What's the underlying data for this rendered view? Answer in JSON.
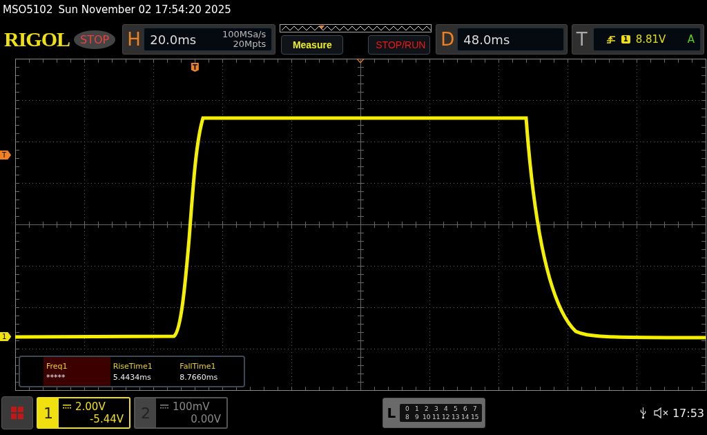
{
  "header": {
    "model": "MSO5102",
    "datetime": "Sun November 02 17:54:20 2025"
  },
  "toolbar": {
    "logo": "RIGOL",
    "run_state": "STOP",
    "running": false
  },
  "horizontal": {
    "letter": "H",
    "timebase": "20.0ms",
    "sample_rate": "100MSa/s",
    "memory_depth": "20Mpts"
  },
  "buttons": [
    {
      "label": "Measure",
      "kind": "measure"
    },
    {
      "label": "STOP/RUN",
      "kind": "run-control"
    }
  ],
  "delay": {
    "letter": "D",
    "value": "48.0ms"
  },
  "trigger": {
    "letter": "T",
    "source": "1",
    "level": "8.81V",
    "mode": "A"
  },
  "plot": {
    "trigger_position_marker": "T",
    "trigger_level_marker": "T",
    "channel_marker": "1"
  },
  "measurements": [
    {
      "name": "Freq1",
      "value": "*****",
      "selected": true
    },
    {
      "name": "RiseTime1",
      "value": "5.4434ms",
      "selected": false
    },
    {
      "name": "FallTime1",
      "value": "8.7660ms",
      "selected": false
    }
  ],
  "channels": [
    {
      "number": "1",
      "scale": "2.00V",
      "offset": "-5.44V",
      "active": true
    },
    {
      "number": "2",
      "scale": "100mV",
      "offset": "0.00V",
      "active": false
    }
  ],
  "logic": {
    "letter": "L",
    "rows": [
      [
        "0",
        "1",
        "2",
        "3",
        "4",
        "5",
        "6",
        "7"
      ],
      [
        "8",
        "9",
        "10",
        "11",
        "12",
        "13",
        "14",
        "15"
      ]
    ]
  },
  "status": {
    "time": "17:53"
  }
}
